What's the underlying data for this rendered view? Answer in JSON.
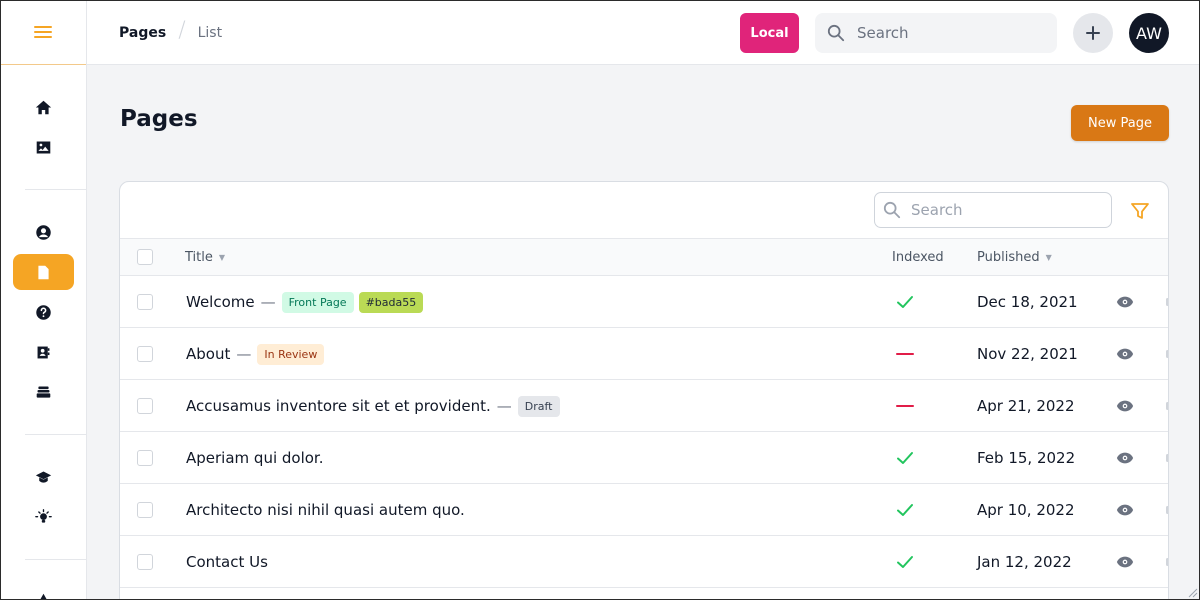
{
  "header": {
    "breadcrumb": [
      "Pages",
      "List"
    ],
    "local_label": "Local",
    "search_placeholder": "Search",
    "avatar_initials": "AW"
  },
  "main": {
    "title": "Pages",
    "new_button": "New Page"
  },
  "table": {
    "search_placeholder": "Search",
    "columns": {
      "title": "Title",
      "indexed": "Indexed",
      "published": "Published"
    },
    "rows": [
      {
        "title": "Welcome",
        "badges": [
          {
            "text": "Front Page",
            "bg": "#d1fae5",
            "fg": "#047857"
          },
          {
            "text": "#bada55",
            "bg": "#bada55",
            "fg": "#1f2937"
          }
        ],
        "indexed": true,
        "published": "Dec 18, 2021"
      },
      {
        "title": "About",
        "badges": [
          {
            "text": "In Review",
            "bg": "#ffedd5",
            "fg": "#9a3412"
          }
        ],
        "indexed": false,
        "published": "Nov 22, 2021"
      },
      {
        "title": "Accusamus inventore sit et et provident.",
        "badges": [
          {
            "text": "Draft",
            "bg": "#e5e7eb",
            "fg": "#374151"
          }
        ],
        "indexed": false,
        "published": "Apr 21, 2022"
      },
      {
        "title": "Aperiam qui dolor.",
        "badges": [],
        "indexed": true,
        "published": "Feb 15, 2022"
      },
      {
        "title": "Architecto nisi nihil quasi autem quo.",
        "badges": [],
        "indexed": true,
        "published": "Apr 10, 2022"
      },
      {
        "title": "Contact Us",
        "badges": [],
        "indexed": true,
        "published": "Jan 12, 2022"
      }
    ]
  },
  "colors": {
    "accent": "#f5a524",
    "brand_button": "#d97815",
    "local_badge": "#e0247a",
    "indexed_yes": "#22c55e",
    "indexed_no": "#e11d48"
  },
  "sidebar_icons": [
    "menu-icon",
    "home-icon",
    "image-icon",
    "user-icon",
    "document-icon",
    "help-icon",
    "address-book-icon",
    "stack-icon",
    "graduation-cap-icon",
    "lightbulb-icon",
    "triangle-icon"
  ]
}
